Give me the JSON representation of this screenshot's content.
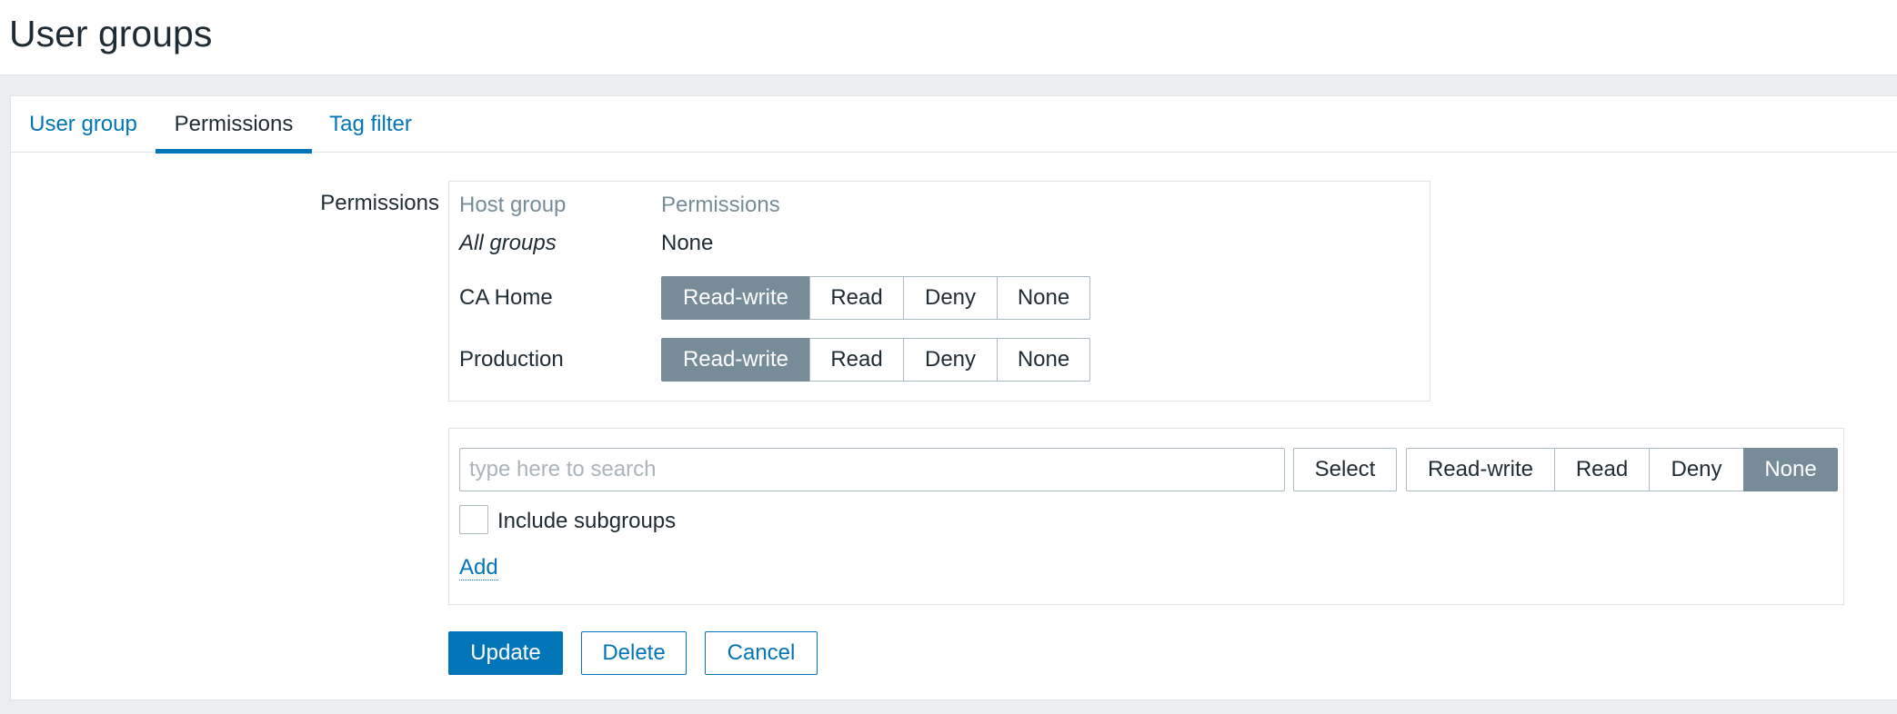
{
  "page": {
    "title": "User groups"
  },
  "tabs": [
    {
      "label": "User group"
    },
    {
      "label": "Permissions"
    },
    {
      "label": "Tag filter"
    }
  ],
  "active_tab": "Permissions",
  "permissions": {
    "label": "Permissions",
    "table": {
      "headers": {
        "host_group": "Host group",
        "permissions": "Permissions"
      },
      "all_groups": {
        "name": "All groups",
        "value": "None"
      },
      "rows": [
        {
          "name": "CA Home",
          "selected": "Read-write"
        },
        {
          "name": "Production",
          "selected": "Read-write"
        }
      ],
      "options": [
        "Read-write",
        "Read",
        "Deny",
        "None"
      ]
    }
  },
  "add_section": {
    "search_placeholder": "type here to search",
    "search_value": "",
    "select_label": "Select",
    "options": [
      "Read-write",
      "Read",
      "Deny",
      "None"
    ],
    "selected": "None",
    "include_subgroups_label": "Include subgroups",
    "include_subgroups_checked": false,
    "add_label": "Add"
  },
  "actions": {
    "update": "Update",
    "delete": "Delete",
    "cancel": "Cancel"
  },
  "colors": {
    "accent": "#0275b8",
    "segment_selected": "#768d99",
    "header_text": "#768d99"
  }
}
